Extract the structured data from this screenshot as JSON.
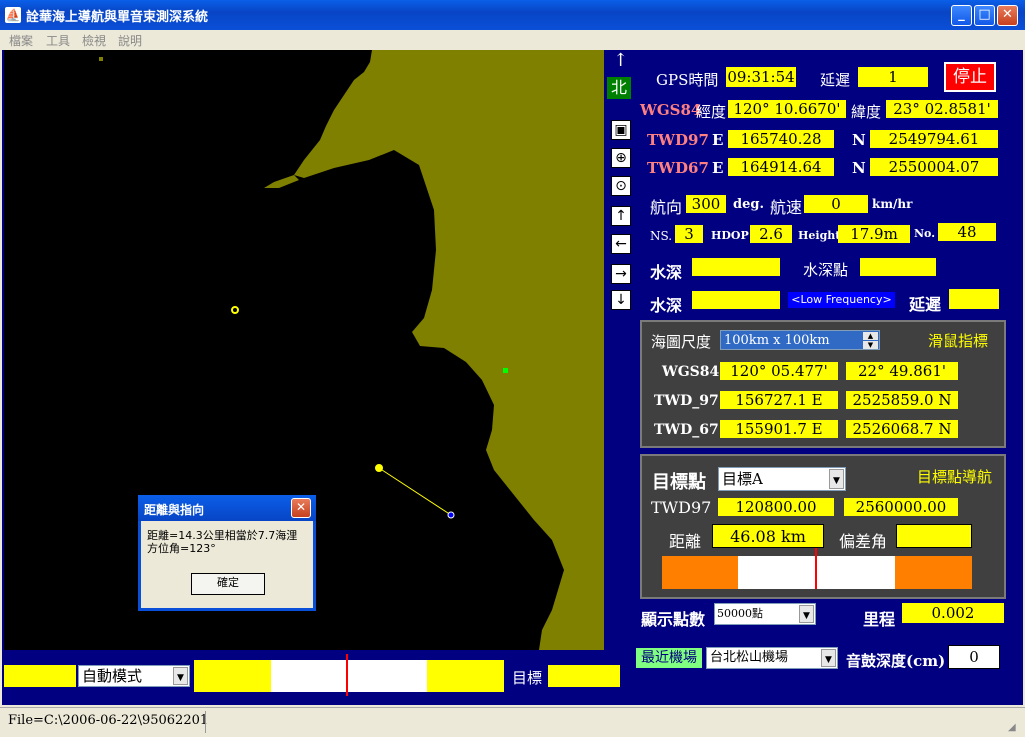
{
  "window": {
    "title": "詮華海上導航與單音束測深系統",
    "minimize": "_",
    "maximize": "□",
    "close": "✕"
  },
  "menu": [
    "檔案",
    "工具",
    "檢視",
    "說明"
  ],
  "gps": {
    "time_label": "GPS時間",
    "time": "09:31:54",
    "delay_label": "延遲",
    "delay": "1",
    "stop_label": "停止"
  },
  "wgs84": {
    "label": "WGS84",
    "lon_label": "經度",
    "lon": "120° 10.6670'",
    "lat_label": "緯度",
    "lat": "23° 02.8581'"
  },
  "twd97": {
    "label": "TWD97",
    "e_label": "E",
    "e": "165740.28",
    "n_label": "N",
    "n": "2549794.61"
  },
  "twd67": {
    "label": "TWD67",
    "e_label": "E",
    "e": "164914.64",
    "n_label": "N",
    "n": "2550004.07"
  },
  "nav": {
    "heading_label": "航向",
    "heading": "300",
    "heading_unit": "deg.",
    "speed_label": "航速",
    "speed": "0",
    "speed_unit": "km/hr",
    "ns_label": "NS.",
    "ns": "3",
    "hdop_label": "HDOP",
    "hdop": "2.6",
    "height_label": "Height",
    "height": "17.9m",
    "no_label": "No.",
    "no": "48"
  },
  "depth": {
    "depth_label": "水深",
    "depth": "",
    "point_label": "水深點",
    "point": "",
    "depth2_label": "水深",
    "depth2": "",
    "freq_label": "<Low Frequency>",
    "delay_label": "延遲",
    "delay": ""
  },
  "north_label": "北",
  "mouse_panel": {
    "scale_label": "海圖尺度",
    "scale_value": "100km x 100km",
    "title": "滑鼠指標",
    "wgs84_label": "WGS84",
    "wgs84_lon": "120° 05.477'",
    "wgs84_lat": "22° 49.861'",
    "twd97_label": "TWD_97",
    "twd97_e": "156727.1 E",
    "twd97_n": "2525859.0 N",
    "twd67_label": "TWD_67",
    "twd67_e": "155901.7 E",
    "twd67_n": "2526068.7 N"
  },
  "target_panel": {
    "label": "目標點",
    "select": "目標A",
    "title": "目標點導航",
    "twd97_label": "TWD97",
    "twd97_e": "120800.00",
    "twd97_n": "2560000.00",
    "distance_label": "距離",
    "distance": "46.08 km",
    "offset_label": "偏差角",
    "offset": ""
  },
  "display": {
    "points_label": "顯示點數",
    "points_value": "50000點",
    "mileage_label": "里程",
    "mileage": "0.002"
  },
  "airport": {
    "label": "最近機場",
    "value": "台北松山機場",
    "sounder_label": "音鼓深度(cm)",
    "sounder_value": "0"
  },
  "bottom": {
    "mode": "自動模式",
    "target_label": "目標"
  },
  "dialog": {
    "title": "距離與指向",
    "line1": "距離=14.3公里相當於7.7海浬",
    "line2": "方位角=123°",
    "ok": "確定"
  },
  "status": {
    "file": "File=C:\\2006-06-22\\95062201"
  },
  "colors": {
    "land": "#808000",
    "sea": "#000000",
    "panel_bg": "#000080",
    "value_bg": "#ffff00",
    "indicator_orange": "#ff8000"
  }
}
